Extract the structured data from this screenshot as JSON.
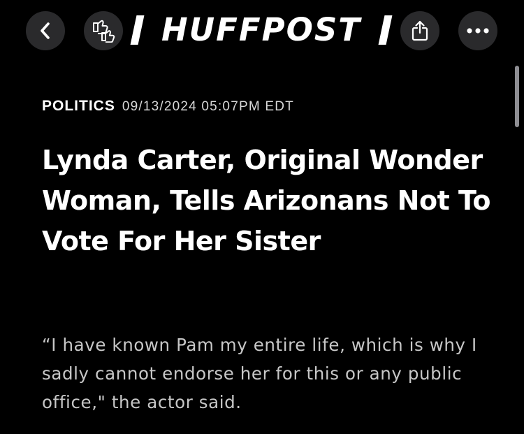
{
  "toolbar": {
    "back_icon": "chevron-left-icon",
    "reaction_icon": "thumbs-reaction-icon",
    "share_icon": "share-icon",
    "more_icon": "ellipsis-icon",
    "button_color": "#2a2a2c"
  },
  "brand": {
    "logo_text": "HUFFPOST"
  },
  "article": {
    "section": "POLITICS",
    "timestamp": "09/13/2024 05:07PM EDT",
    "headline": "Lynda Carter, Original Wonder Woman, Tells Arizonans Not To Vote For Her Sister",
    "dek": "“I have known Pam my entire life, which is why I sadly cannot endorse her for this or any public office,\" the actor said."
  },
  "colors": {
    "background": "#000000",
    "text": "#ffffff",
    "dek_text": "#c7c7c7"
  }
}
